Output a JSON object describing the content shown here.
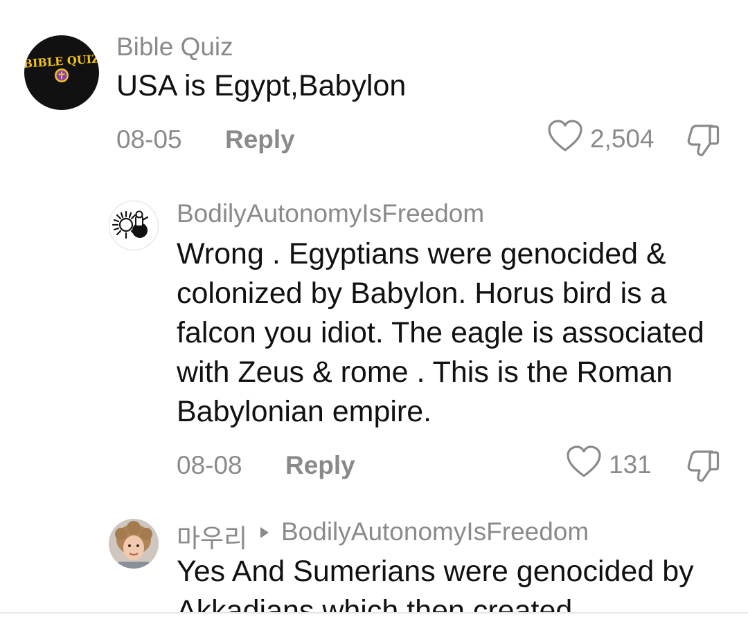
{
  "comments": [
    {
      "avatar_text": "BIBLE QUIZ",
      "username": "Bible Quiz",
      "text": "USA is Egypt,Babylon",
      "date": "08-05",
      "reply_label": "Reply",
      "likes": "2,504"
    },
    {
      "username": "BodilyAutonomyIsFreedom",
      "text": "Wrong . Egyptians were genocided & colonized by Babylon. Horus bird is a falcon you idiot. The eagle is associated with Zeus & rome . This is the Roman Babylonian empire.",
      "date": "08-08",
      "reply_label": "Reply",
      "likes": "131"
    },
    {
      "username": "마우리",
      "reply_to": "BodilyAutonomyIsFreedom",
      "text": "Yes And Sumerians were genocided by Akkadians which then created"
    }
  ],
  "colors": {
    "text": "#111111",
    "muted": "#8a8a8a",
    "avatar_bg": "#111111",
    "avatar_logo": "#f2c318",
    "avatar_cross": "#8a3fb8"
  },
  "icons": {
    "like": "heart-outline-icon",
    "dislike": "thumbs-down-outline-icon",
    "reply_arrow": "triangle-right-icon"
  }
}
